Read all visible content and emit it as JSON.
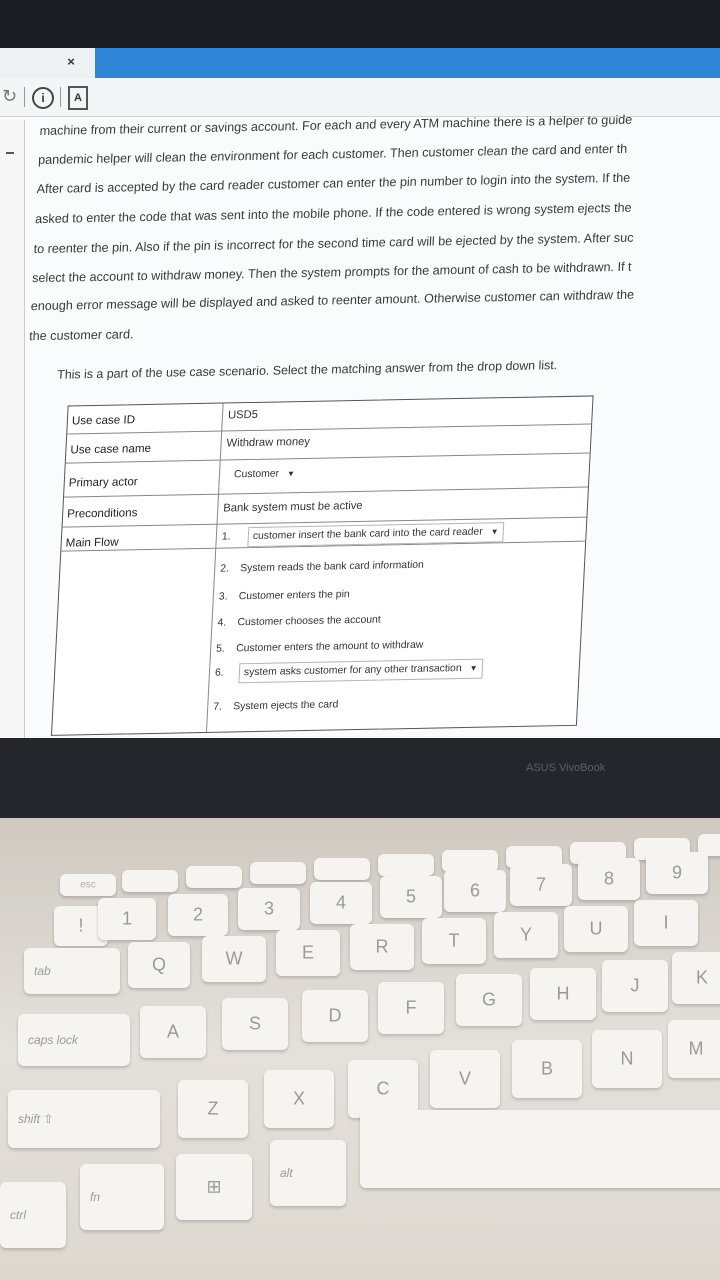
{
  "browser": {
    "tab_close": "×",
    "info_glyph": "i",
    "doc_glyph": "A"
  },
  "document": {
    "paragraph_lines": [
      "machine from their current or savings account. For each and every ATM machine there is a helper to guide",
      "pandemic helper will clean the environment for each customer. Then customer clean the card and enter th",
      "After card is accepted by the card reader customer can enter the pin number to login into the system. If the",
      "asked to enter the code that was sent into the mobile phone. If the code entered is wrong system ejects the",
      "to reenter the pin. Also if the pin is incorrect for the second time card will be ejected by the system. After suc",
      "select the account to withdraw money. Then the system prompts for the amount of cash to be withdrawn. If t",
      "enough error message will be displayed and asked to reenter amount. Otherwise customer can withdraw the",
      "the customer card."
    ],
    "instruction": "This is a part of the use case scenario. Select the matching answer from the drop down list."
  },
  "use_case_table": {
    "use_case_id_label": "Use case ID",
    "use_case_id_value": "USD5",
    "use_case_name_label": "Use case name",
    "use_case_name_value": "Withdraw money",
    "primary_actor_label": "Primary actor",
    "primary_actor_value": "Customer",
    "preconditions_label": "Preconditions",
    "preconditions_value": "Bank system must be active",
    "main_flow_label": "Main Flow",
    "steps": [
      {
        "num": "1.",
        "text": "customer insert the bank card into the card reader",
        "dropdown": true
      },
      {
        "num": "2.",
        "text": "System reads the bank card information",
        "dropdown": false
      },
      {
        "num": "3.",
        "text": "Customer enters the pin",
        "dropdown": false
      },
      {
        "num": "4.",
        "text": "Customer chooses the account",
        "dropdown": false
      },
      {
        "num": "5.",
        "text": "Customer enters the amount to withdraw",
        "dropdown": false
      },
      {
        "num": "6.",
        "text": "system asks customer for any other transaction",
        "dropdown": true
      },
      {
        "num": "7.",
        "text": "System ejects the card",
        "dropdown": false
      }
    ],
    "dropdown_arrow": "▼"
  },
  "laptop": {
    "brand": "ASUS VivoBook"
  },
  "keyboard": {
    "row_fn": [
      "esc",
      "",
      "",
      "",
      "",
      "",
      "",
      "",
      "",
      "",
      ""
    ],
    "row_num": [
      "!",
      "1",
      "2",
      "3",
      "4",
      "5",
      "6",
      "7",
      "8",
      "9"
    ],
    "row_q": [
      "tab",
      "Q",
      "W",
      "E",
      "R",
      "T",
      "Y",
      "U",
      "I"
    ],
    "row_a": [
      "caps lock",
      "A",
      "S",
      "D",
      "F",
      "G",
      "H",
      "J",
      "K"
    ],
    "row_z": [
      "shift ⇧",
      "Z",
      "X",
      "C",
      "V",
      "B",
      "N",
      "M"
    ],
    "row_bottom": [
      "ctrl",
      "fn",
      "⊞",
      "alt"
    ]
  }
}
